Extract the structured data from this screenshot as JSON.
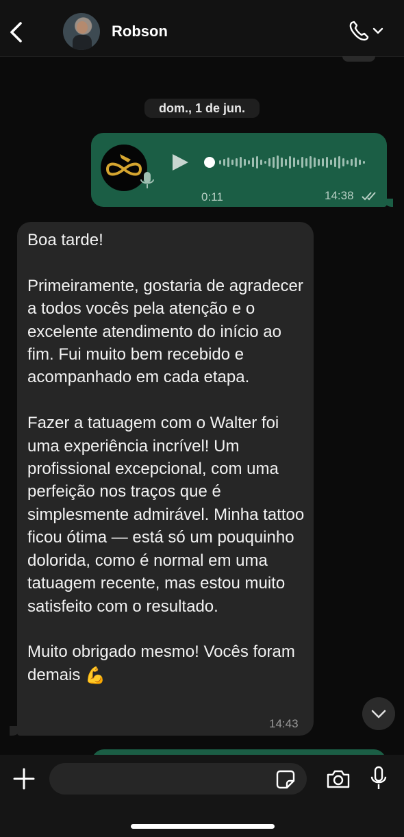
{
  "header": {
    "contact_name": "Robson",
    "back_icon": "chevron-left-icon",
    "call_icon": "phone-icon"
  },
  "date_chip": "dom., 1 de jun.",
  "voice_message": {
    "duration": "0:11",
    "time": "14:38",
    "status": "read"
  },
  "text_message": {
    "body": "Boa tarde!\n\nPrimeiramente, gostaria de agradecer a todos vocês pela atenção e o excelente atendimento do início ao fim. Fui muito bem recebido e acompanhado em cada etapa.\n\nFazer a tatuagem com o Walter foi uma experiência incrível! Um profissional excepcional, com uma perfeição nos traços que é simplesmente admirável. Minha tattoo ficou ótima — está só um pouquinho dolorida, como é normal em uma tatuagem recente, mas estou muito satisfeito com o resultado.\n\nMuito obrigado mesmo! Vocês foram demais",
    "emoji": "💪",
    "time": "14:43"
  },
  "composer": {
    "placeholder": ""
  },
  "colors": {
    "outgoing_bubble": "#1b5e45",
    "incoming_bubble": "#262626",
    "background": "#0b0b0b"
  }
}
